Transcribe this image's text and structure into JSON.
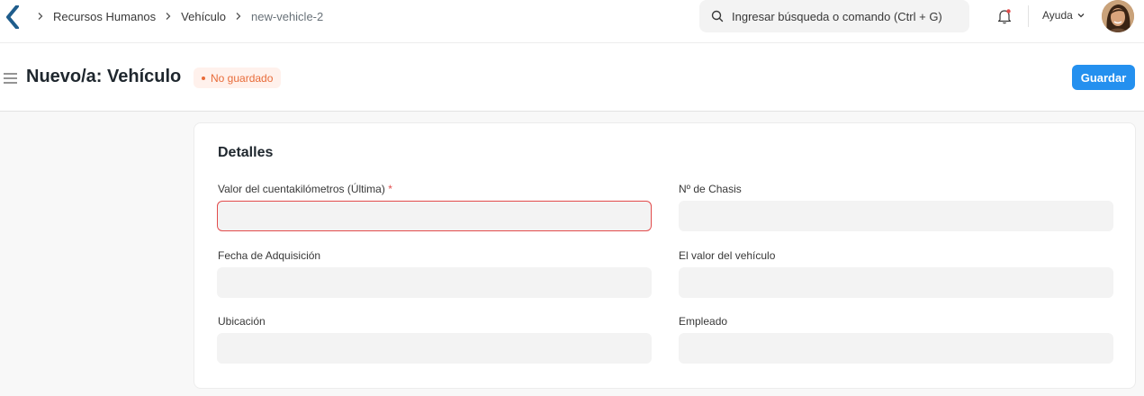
{
  "breadcrumb": {
    "items": [
      "Recursos Humanos",
      "Vehículo"
    ],
    "current": "new-vehicle-2"
  },
  "search": {
    "placeholder": "Ingresar búsqueda o comando (Ctrl + G)"
  },
  "help": {
    "label": "Ayuda"
  },
  "page": {
    "title": "Nuevo/a: Vehículo",
    "status_badge": "No guardado",
    "save_label": "Guardar"
  },
  "form": {
    "section_title": "Detalles",
    "fields": {
      "odometer": {
        "label": "Valor del cuentakilómetros (Última)",
        "required_mark": "*",
        "value": ""
      },
      "chassis": {
        "label": "Nº de Chasis",
        "value": ""
      },
      "acquisition_date": {
        "label": "Fecha de Adquisición",
        "value": ""
      },
      "vehicle_value": {
        "label": "El valor del vehículo",
        "value": ""
      },
      "location": {
        "label": "Ubicación",
        "value": ""
      },
      "employee": {
        "label": "Empleado",
        "value": ""
      }
    }
  },
  "colors": {
    "primary": "#2490ef",
    "badge_text": "#e86c3a",
    "badge_bg": "#fff1ec",
    "error": "#e24c4c"
  }
}
